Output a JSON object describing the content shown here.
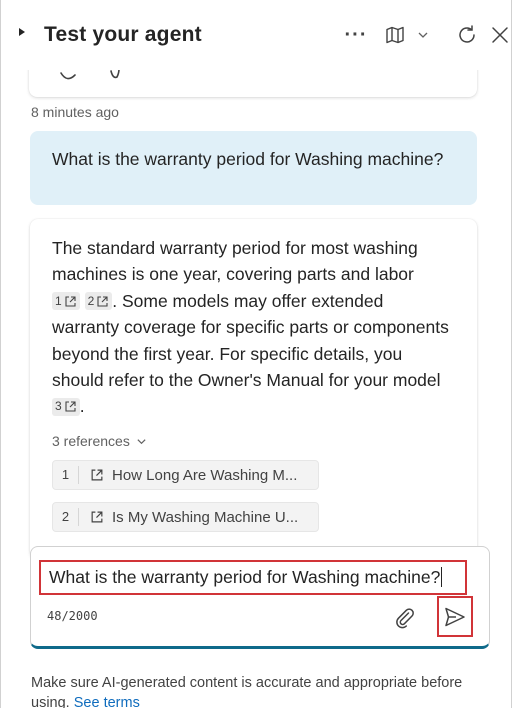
{
  "header": {
    "title": "Test your agent",
    "more_label": "···",
    "icons": [
      "expand-caret-icon",
      "more-icon",
      "map-icon",
      "chevron-down-icon",
      "refresh-icon",
      "close-icon"
    ]
  },
  "conversation": {
    "timestamp": "8 minutes ago",
    "user_message": "What is the warranty period for Washing machine?",
    "bot_answer": {
      "part1": "The standard warranty period for most washing machines is one year, covering parts and labor",
      "cite1": "1",
      "cite2": "2",
      "part2": ". Some models may offer extended warranty coverage for specific parts or components beyond the first year. For specific details, you should refer to the Owner's Manual for your model",
      "cite3": "3",
      "part3": "."
    },
    "references_toggle": "3 references",
    "references": [
      {
        "num": "1",
        "title": "How Long Are Washing M..."
      },
      {
        "num": "2",
        "title": "Is My Washing Machine U..."
      }
    ]
  },
  "composer": {
    "input_value": "What is the warranty period for Washing machine?",
    "counter": "48/2000"
  },
  "footer": {
    "text": "Make sure AI-generated content is accurate and appropriate before using.",
    "link": "See terms"
  },
  "colors": {
    "user_bubble": "#e0f0f8",
    "highlight_border": "#d13438",
    "accent": "#0f6a8a",
    "link": "#0f6cbd"
  }
}
